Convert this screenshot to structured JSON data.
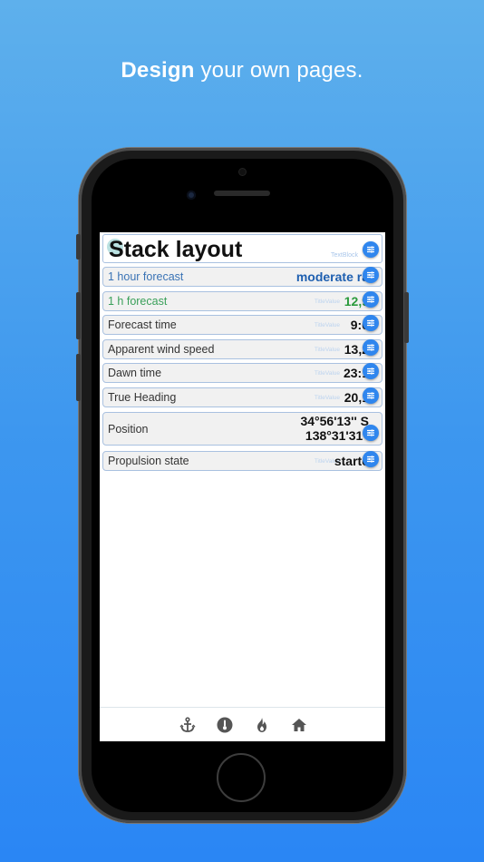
{
  "headline": {
    "bold": "Design",
    "rest": "your own pages."
  },
  "screen": {
    "title": "Stack layout",
    "title_tag": "TextBlock",
    "rows": [
      {
        "label": "1 hour forecast",
        "value": "moderate ra",
        "ghost": "",
        "label_color": "#3a73b5",
        "value_color": "#1e5fb0"
      },
      {
        "label": "1 h forecast",
        "value": "12,9",
        "ghost": "TitleValue",
        "label_color": "#3aa05a",
        "value_color": "#2b9a3c"
      },
      {
        "label": "Forecast time",
        "value": "9:0",
        "ghost": "TitleValue",
        "label_color": "#333333",
        "value_color": "#111111"
      },
      {
        "label": "Apparent wind speed",
        "value": "13,2",
        "ghost": "TitleValue",
        "label_color": "#333333",
        "value_color": "#111111"
      },
      {
        "label": "Dawn time",
        "value": "23:1",
        "ghost": "TitleValue",
        "label_color": "#333333",
        "value_color": "#111111"
      },
      {
        "label": "True Heading",
        "value": "20,1",
        "ghost": "TitleValue",
        "label_color": "#333333",
        "value_color": "#111111"
      },
      {
        "label": "Position",
        "value": "34°56'13'' S",
        "value2": "138°31'31''",
        "ghost": "",
        "label_color": "#333333",
        "value_color": "#111111"
      },
      {
        "label": "Propulsion state",
        "value": "starte",
        "ghost": "TitleValue",
        "label_color": "#333333",
        "value_color": "#111111"
      }
    ],
    "nav": [
      {
        "name": "anchor-icon"
      },
      {
        "name": "thermometer-icon"
      },
      {
        "name": "flame-icon"
      },
      {
        "name": "home-icon"
      }
    ]
  },
  "colors": {
    "accent": "#2f86ee",
    "row_border": "#a9c1e0",
    "row_bg": "#f1f1f1"
  }
}
